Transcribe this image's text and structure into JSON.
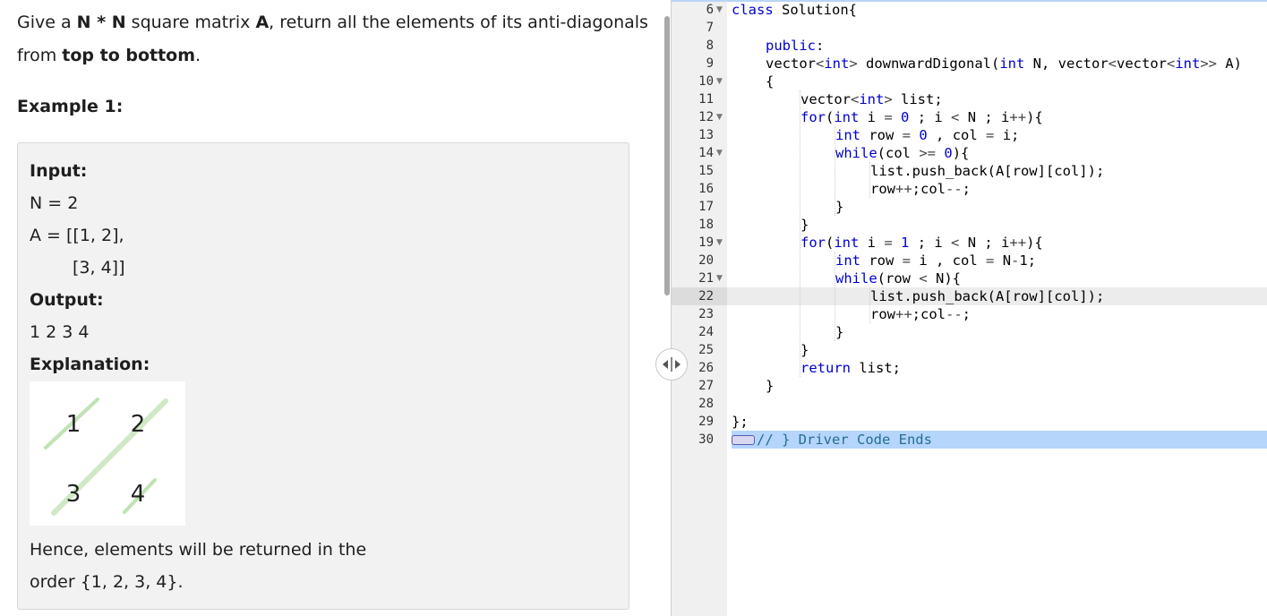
{
  "problem": {
    "intro_prefix": "Give a ",
    "intro_bold1": "N * N",
    "intro_mid": " square matrix ",
    "intro_bold2": "A",
    "intro_suffix": ", return all the elements of its anti-diagonals",
    "intro_line2_prefix": "from ",
    "intro_line2_bold": "top to bottom",
    "intro_line2_suffix": ".",
    "example_heading": "Example 1:"
  },
  "example": {
    "input_label": "Input:",
    "n_line": "N = 2",
    "a_line1": "A = [[1, 2],",
    "a_line2": "[3, 4]]",
    "output_label": "Output:",
    "output_value": "1 2 3 4",
    "explanation_label": "Explanation:",
    "matrix": [
      "1",
      "2",
      "3",
      "4"
    ],
    "hence_line1": "Hence, elements will be returned in the",
    "hence_line2": "order {1, 2, 3, 4}."
  },
  "editor": {
    "line_numbers": [
      "6",
      "7",
      "8",
      "9",
      "10",
      "11",
      "12",
      "13",
      "14",
      "15",
      "16",
      "17",
      "18",
      "19",
      "20",
      "21",
      "22",
      "23",
      "24",
      "25",
      "26",
      "27",
      "28",
      "29",
      "30"
    ],
    "code": {
      "l6_kw": "class",
      "l6_rest": " Solution{",
      "l8_kw": "public",
      "l8_rest": ":",
      "l9_a": "vector",
      "l9_b": "<",
      "l9_c": "int",
      "l9_d": ">",
      "l9_e": " downwardDigonal(",
      "l9_f": "int",
      "l9_g": " N, ",
      "l9_h": "vector",
      "l9_i": "<",
      "l9_j": "vector",
      "l9_k": "<",
      "l9_l": "int",
      "l9_m": ">>",
      "l9_n": " A)",
      "l10": "{",
      "l11_a": "vector",
      "l11_b": "<",
      "l11_c": "int",
      "l11_d": ">",
      "l11_e": " list;",
      "l12_kw": "for",
      "l12_a": "(",
      "l12_int": "int",
      "l12_b": " i ",
      "l12_eq": "=",
      "l12_sp": " ",
      "l12_num": "0",
      "l12_c": " ; i ",
      "l12_lt": "<",
      "l12_d": " N ; i",
      "l12_pp": "++",
      "l12_e": "){",
      "l13_int": "int",
      "l13_a": " row ",
      "l13_eq": "=",
      "l13_sp": " ",
      "l13_num": "0",
      "l13_b": " , col ",
      "l13_eq2": "=",
      "l13_c": " i;",
      "l14_kw": "while",
      "l14_a": "(col ",
      "l14_ge": ">=",
      "l14_sp": " ",
      "l14_num": "0",
      "l14_b": "){",
      "l15": "list.push_back(A[row][col]);",
      "l16_a": "row",
      "l16_pp": "++",
      "l16_b": ";col",
      "l16_mm": "--",
      "l16_c": ";",
      "l17": "}",
      "l18": "}",
      "l19_kw": "for",
      "l19_a": "(",
      "l19_int": "int",
      "l19_b": " i ",
      "l19_eq": "=",
      "l19_sp": " ",
      "l19_num": "1",
      "l19_c": " ; i ",
      "l19_lt": "<",
      "l19_d": " N ; i",
      "l19_pp": "++",
      "l19_e": "){",
      "l20_int": "int",
      "l20_a": " row ",
      "l20_eq": "=",
      "l20_b": " i , col ",
      "l20_eq2": "=",
      "l20_c": " N",
      "l20_minus": "-",
      "l20_d": "1;",
      "l21_kw": "while",
      "l21_a": "(row ",
      "l21_lt": "<",
      "l21_b": " N){",
      "l22": "list.push_back(A[row][col]);",
      "l23_a": "row",
      "l23_pp": "++",
      "l23_b": ";col",
      "l23_mm": "--",
      "l23_c": ";",
      "l24": "}",
      "l25": "}",
      "l26_kw": "return",
      "l26_rest": " list;",
      "l27": "}",
      "l29": "};",
      "l30": "// } Driver Code Ends"
    }
  },
  "colors": {
    "keyword": "#0000cd",
    "comment": "#236e92",
    "selection": "#b5d5fb",
    "gutter": "#f0f0f0",
    "illustration_line": "#bfe3b4"
  },
  "icons": {
    "split_handle": "split-resize-icon",
    "fold": "fold-arrow-icon"
  }
}
